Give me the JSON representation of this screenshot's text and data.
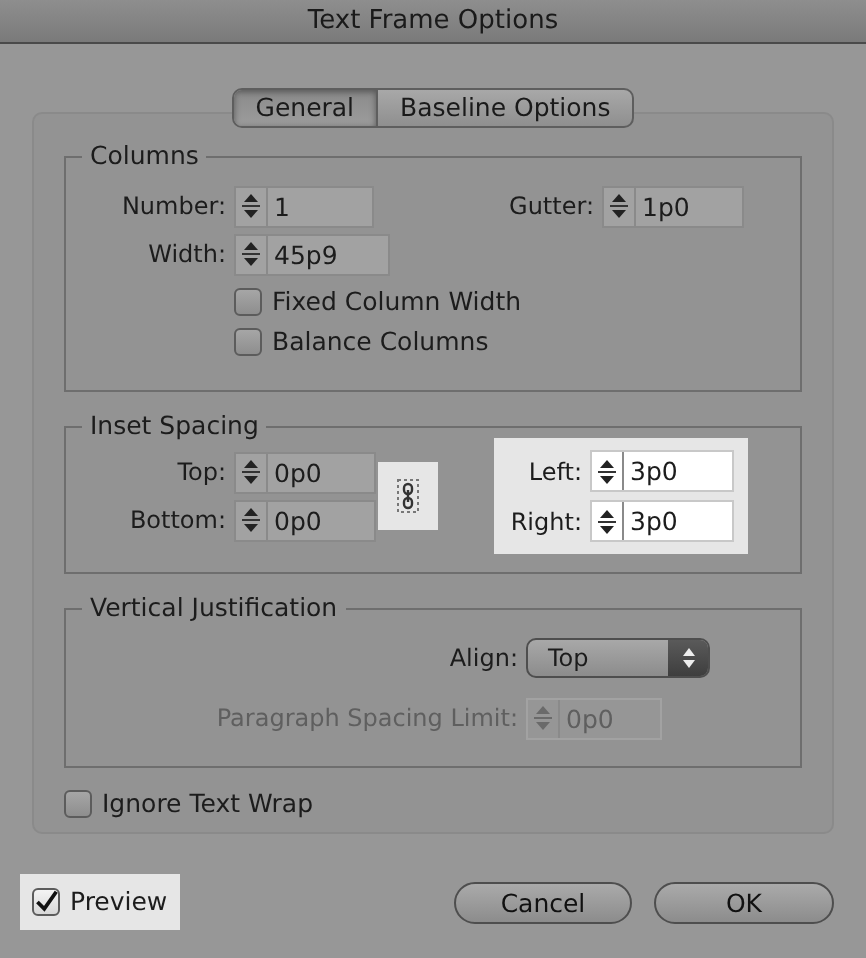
{
  "window": {
    "title": "Text Frame Options"
  },
  "tabs": [
    {
      "label": "General",
      "selected": true
    },
    {
      "label": "Baseline Options",
      "selected": false
    }
  ],
  "columns": {
    "title": "Columns",
    "fields": [
      {
        "label": "Number:",
        "value": "1"
      },
      {
        "label": "Gutter:",
        "value": "1p0"
      },
      {
        "label": "Width:",
        "value": "45p9"
      }
    ],
    "checkboxes": [
      {
        "label": "Fixed Column Width",
        "checked": false
      },
      {
        "label": "Balance Columns",
        "checked": false
      }
    ]
  },
  "inset_spacing": {
    "title": "Inset Spacing",
    "fields": [
      {
        "label": "Top:",
        "value": "0p0",
        "highlighted": false
      },
      {
        "label": "Left:",
        "value": "3p0",
        "highlighted": true
      },
      {
        "label": "Bottom:",
        "value": "0p0",
        "highlighted": false
      },
      {
        "label": "Right:",
        "value": "3p0",
        "highlighted": true
      }
    ],
    "link": {
      "highlighted": true
    }
  },
  "vertical_justification": {
    "title": "Vertical Justification",
    "align": {
      "label": "Align:",
      "value": "Top"
    },
    "spacing_limit": {
      "label": "Paragraph Spacing Limit:",
      "value": "0p0",
      "disabled": true
    }
  },
  "ignore_text_wrap": {
    "label": "Ignore Text Wrap",
    "checked": false
  },
  "preview": {
    "label": "Preview",
    "checked": true,
    "highlighted": true
  },
  "buttons": [
    {
      "label": "Cancel"
    },
    {
      "label": "OK"
    }
  ]
}
